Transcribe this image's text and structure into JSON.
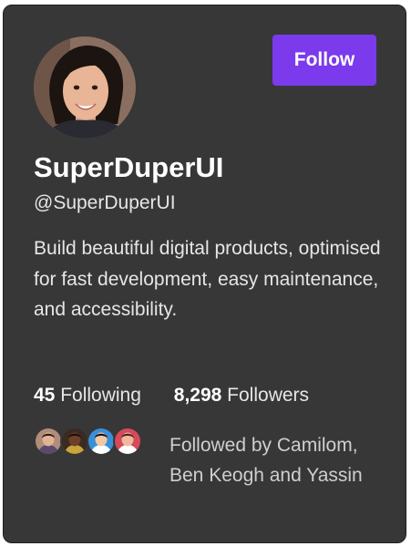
{
  "profile": {
    "name": "SuperDuperUI",
    "handle": "@SuperDuperUI",
    "bio": "Build beautiful digital products, optimised for fast development, easy maintenance, and accessibility.",
    "avatar_icon": "person-photo-avatar"
  },
  "actions": {
    "follow_label": "Follow",
    "accent_color": "#7c3aed"
  },
  "stats": {
    "following_count": "45",
    "following_label": "Following",
    "followers_count": "8,298",
    "followers_label": "Followers"
  },
  "social_proof": {
    "text": "Followed by Camilom, Ben Keogh and Yassin",
    "avatars": [
      {
        "skin": "#e4b294",
        "hair": "#2b1a12",
        "shirt": "#5a4a6a",
        "bg": "#b08d7a"
      },
      {
        "skin": "#6b3f2a",
        "hair": "#1a0f0a",
        "shirt": "#c8a43a",
        "bg": "#3b2a22"
      },
      {
        "skin": "#f1c9a5",
        "hair": "#111111",
        "shirt": "#ffffff",
        "bg": "#3a8fd8"
      },
      {
        "skin": "#f0b8a0",
        "hair": "#4a2418",
        "shirt": "#ffffff",
        "bg": "#d64a5a"
      }
    ]
  }
}
